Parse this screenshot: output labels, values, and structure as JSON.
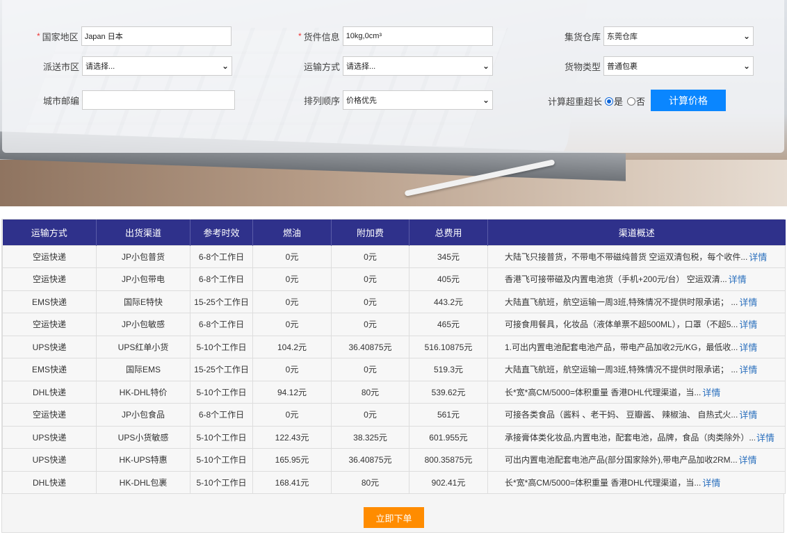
{
  "form": {
    "country_label": "国家地区",
    "country_value": "Japan 日本",
    "cargo_label": "货件信息",
    "cargo_value": "10kg,0cm³",
    "warehouse_label": "集货仓库",
    "warehouse_value": "东莞仓库",
    "city_label": "派送市区",
    "city_value": "请选择...",
    "transport_label": "运输方式",
    "transport_value": "请选择...",
    "goods_label": "货物类型",
    "goods_value": "普通包裹",
    "zip_label": "城市邮编",
    "zip_value": "",
    "sort_label": "排列顺序",
    "sort_value": "价格优先",
    "oversize_label": "计算超重超长",
    "yes_label": "是",
    "no_label": "否",
    "calc_button": "计算价格",
    "required_mark": "*"
  },
  "table": {
    "headers": [
      "运输方式",
      "出货渠道",
      "参考时效",
      "燃油",
      "附加费",
      "总费用",
      "渠道概述"
    ],
    "more_label": "详情",
    "rows": [
      [
        "空运快递",
        "JP小包普货",
        "6-8个工作日",
        "0元",
        "0元",
        "345元",
        "大陆飞只接普货，不带电不带磁纯普货 空运双清包税，每个收件..."
      ],
      [
        "空运快递",
        "JP小包带电",
        "6-8个工作日",
        "0元",
        "0元",
        "405元",
        "香港飞可接带磁及内置电池货（手机+200元/台） 空运双清..."
      ],
      [
        "EMS快递",
        "国际E特快",
        "15-25个工作日",
        "0元",
        "0元",
        "443.2元",
        "大陆直飞航班，航空运输一周3班,特殊情况不提供时限承诺； ..."
      ],
      [
        "空运快递",
        "JP小包敏感",
        "6-8个工作日",
        "0元",
        "0元",
        "465元",
        "可接食用餐具，化妆品（液体单票不超500ML），口罩（不超5..."
      ],
      [
        "UPS快递",
        "UPS红单小货",
        "5-10个工作日",
        "104.2元",
        "36.40875元",
        "516.10875元",
        "1.可出内置电池配套电池产品，带电产品加收2元/KG，最低收..."
      ],
      [
        "EMS快递",
        "国际EMS",
        "15-25个工作日",
        "0元",
        "0元",
        "519.3元",
        "大陆直飞航班，航空运输一周3班,特殊情况不提供时限承诺； ..."
      ],
      [
        "DHL快递",
        "HK-DHL特价",
        "5-10个工作日",
        "94.12元",
        "80元",
        "539.62元",
        "长*宽*高CM/5000=体积重量 香港DHL代理渠道，当..."
      ],
      [
        "空运快递",
        "JP小包食品",
        "6-8个工作日",
        "0元",
        "0元",
        "561元",
        "可接各类食品（酱料 、老干妈、 豆瓣酱、 辣椒油、 自热式火..."
      ],
      [
        "UPS快递",
        "UPS小货敏感",
        "5-10个工作日",
        "122.43元",
        "38.325元",
        "601.955元",
        "承接膏体类化妆品,内置电池，配套电池，品牌，食品（肉类除外）..."
      ],
      [
        "UPS快递",
        "HK-UPS特惠",
        "5-10个工作日",
        "165.95元",
        "36.40875元",
        "800.35875元",
        "可出内置电池配套电池产品(部分国家除外),带电产品加收2RM..."
      ],
      [
        "DHL快递",
        "HK-DHL包裹",
        "5-10个工作日",
        "168.41元",
        "80元",
        "902.41元",
        "长*宽*高CM/5000=体积重量 香港DHL代理渠道，当..."
      ]
    ]
  },
  "order_button": "立即下单",
  "colors": {
    "header_bg": "#2f318b",
    "calc_btn": "#0a86ff",
    "order_btn": "#ff8c00",
    "link": "#2a6fbd"
  }
}
